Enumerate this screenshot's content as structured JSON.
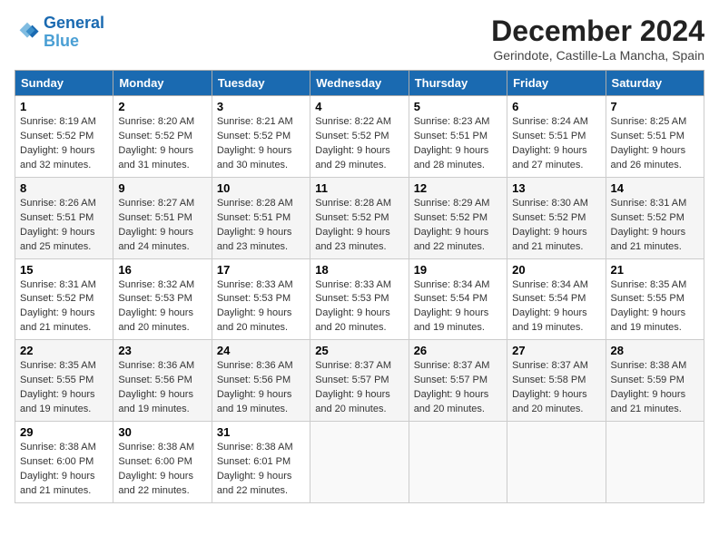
{
  "logo": {
    "line1": "General",
    "line2": "Blue"
  },
  "title": "December 2024",
  "subtitle": "Gerindote, Castille-La Mancha, Spain",
  "days_of_week": [
    "Sunday",
    "Monday",
    "Tuesday",
    "Wednesday",
    "Thursday",
    "Friday",
    "Saturday"
  ],
  "weeks": [
    [
      {
        "day": "1",
        "info": "Sunrise: 8:19 AM\nSunset: 5:52 PM\nDaylight: 9 hours\nand 32 minutes."
      },
      {
        "day": "2",
        "info": "Sunrise: 8:20 AM\nSunset: 5:52 PM\nDaylight: 9 hours\nand 31 minutes."
      },
      {
        "day": "3",
        "info": "Sunrise: 8:21 AM\nSunset: 5:52 PM\nDaylight: 9 hours\nand 30 minutes."
      },
      {
        "day": "4",
        "info": "Sunrise: 8:22 AM\nSunset: 5:52 PM\nDaylight: 9 hours\nand 29 minutes."
      },
      {
        "day": "5",
        "info": "Sunrise: 8:23 AM\nSunset: 5:51 PM\nDaylight: 9 hours\nand 28 minutes."
      },
      {
        "day": "6",
        "info": "Sunrise: 8:24 AM\nSunset: 5:51 PM\nDaylight: 9 hours\nand 27 minutes."
      },
      {
        "day": "7",
        "info": "Sunrise: 8:25 AM\nSunset: 5:51 PM\nDaylight: 9 hours\nand 26 minutes."
      }
    ],
    [
      {
        "day": "8",
        "info": "Sunrise: 8:26 AM\nSunset: 5:51 PM\nDaylight: 9 hours\nand 25 minutes."
      },
      {
        "day": "9",
        "info": "Sunrise: 8:27 AM\nSunset: 5:51 PM\nDaylight: 9 hours\nand 24 minutes."
      },
      {
        "day": "10",
        "info": "Sunrise: 8:28 AM\nSunset: 5:51 PM\nDaylight: 9 hours\nand 23 minutes."
      },
      {
        "day": "11",
        "info": "Sunrise: 8:28 AM\nSunset: 5:52 PM\nDaylight: 9 hours\nand 23 minutes."
      },
      {
        "day": "12",
        "info": "Sunrise: 8:29 AM\nSunset: 5:52 PM\nDaylight: 9 hours\nand 22 minutes."
      },
      {
        "day": "13",
        "info": "Sunrise: 8:30 AM\nSunset: 5:52 PM\nDaylight: 9 hours\nand 21 minutes."
      },
      {
        "day": "14",
        "info": "Sunrise: 8:31 AM\nSunset: 5:52 PM\nDaylight: 9 hours\nand 21 minutes."
      }
    ],
    [
      {
        "day": "15",
        "info": "Sunrise: 8:31 AM\nSunset: 5:52 PM\nDaylight: 9 hours\nand 21 minutes."
      },
      {
        "day": "16",
        "info": "Sunrise: 8:32 AM\nSunset: 5:53 PM\nDaylight: 9 hours\nand 20 minutes."
      },
      {
        "day": "17",
        "info": "Sunrise: 8:33 AM\nSunset: 5:53 PM\nDaylight: 9 hours\nand 20 minutes."
      },
      {
        "day": "18",
        "info": "Sunrise: 8:33 AM\nSunset: 5:53 PM\nDaylight: 9 hours\nand 20 minutes."
      },
      {
        "day": "19",
        "info": "Sunrise: 8:34 AM\nSunset: 5:54 PM\nDaylight: 9 hours\nand 19 minutes."
      },
      {
        "day": "20",
        "info": "Sunrise: 8:34 AM\nSunset: 5:54 PM\nDaylight: 9 hours\nand 19 minutes."
      },
      {
        "day": "21",
        "info": "Sunrise: 8:35 AM\nSunset: 5:55 PM\nDaylight: 9 hours\nand 19 minutes."
      }
    ],
    [
      {
        "day": "22",
        "info": "Sunrise: 8:35 AM\nSunset: 5:55 PM\nDaylight: 9 hours\nand 19 minutes."
      },
      {
        "day": "23",
        "info": "Sunrise: 8:36 AM\nSunset: 5:56 PM\nDaylight: 9 hours\nand 19 minutes."
      },
      {
        "day": "24",
        "info": "Sunrise: 8:36 AM\nSunset: 5:56 PM\nDaylight: 9 hours\nand 19 minutes."
      },
      {
        "day": "25",
        "info": "Sunrise: 8:37 AM\nSunset: 5:57 PM\nDaylight: 9 hours\nand 20 minutes."
      },
      {
        "day": "26",
        "info": "Sunrise: 8:37 AM\nSunset: 5:57 PM\nDaylight: 9 hours\nand 20 minutes."
      },
      {
        "day": "27",
        "info": "Sunrise: 8:37 AM\nSunset: 5:58 PM\nDaylight: 9 hours\nand 20 minutes."
      },
      {
        "day": "28",
        "info": "Sunrise: 8:38 AM\nSunset: 5:59 PM\nDaylight: 9 hours\nand 21 minutes."
      }
    ],
    [
      {
        "day": "29",
        "info": "Sunrise: 8:38 AM\nSunset: 6:00 PM\nDaylight: 9 hours\nand 21 minutes."
      },
      {
        "day": "30",
        "info": "Sunrise: 8:38 AM\nSunset: 6:00 PM\nDaylight: 9 hours\nand 22 minutes."
      },
      {
        "day": "31",
        "info": "Sunrise: 8:38 AM\nSunset: 6:01 PM\nDaylight: 9 hours\nand 22 minutes."
      },
      null,
      null,
      null,
      null
    ]
  ]
}
